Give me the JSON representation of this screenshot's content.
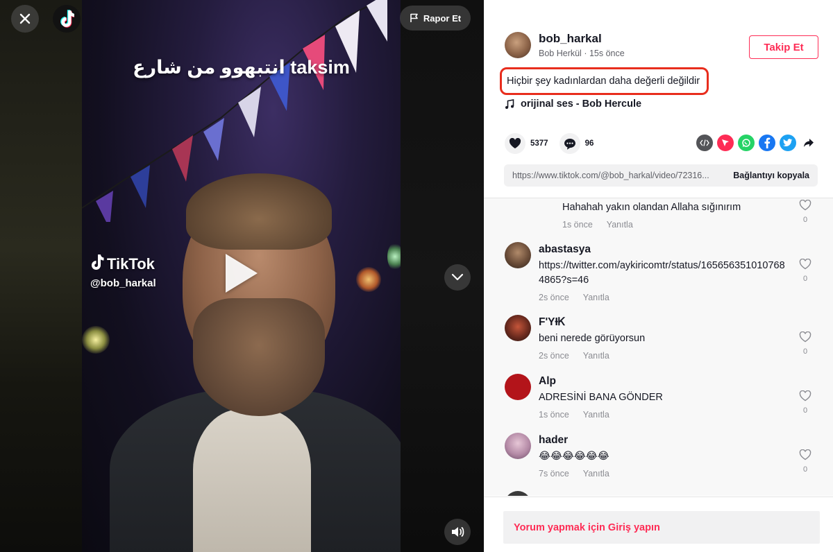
{
  "video": {
    "overlay_text": "انتبهوو من شارع taksim",
    "watermark_brand": "TikTok",
    "watermark_user": "@bob_harkal",
    "report_label": "Rapor Et"
  },
  "author": {
    "handle": "bob_harkal",
    "display_name": "Bob Herkül",
    "time": "15s önce",
    "follow_label": "Takip Et"
  },
  "caption": "Hiçbir şey kadınlardan daha değerli değildir",
  "music": "orijinal ses - Bob Hercule",
  "stats": {
    "likes": "5377",
    "comments": "96"
  },
  "share_icons": [
    "embed-icon",
    "send-icon",
    "whatsapp-icon",
    "facebook-icon",
    "twitter-icon",
    "share-arrow-icon"
  ],
  "link": {
    "url": "https://www.tiktok.com/@bob_harkal/video/72316...",
    "copy_label": "Bağlantıyı kopyala"
  },
  "comments": [
    {
      "name": "",
      "text": "Hahahah yakın olandan Allaha sığınırım",
      "time": "1s önce",
      "reply": "Yanıtla",
      "likes": "0"
    },
    {
      "name": "abastasya",
      "text": "https://twitter.com/aykiricomtr/status/1656563510107684865?s=46",
      "time": "2s önce",
      "reply": "Yanıtla",
      "likes": "0"
    },
    {
      "name": "F'YƗᏦ",
      "text": "beni nerede görüyorsun",
      "time": "2s önce",
      "reply": "Yanıtla",
      "likes": "0"
    },
    {
      "name": "Alp",
      "text": "ADRESİNİ BANA GÖNDER",
      "time": "1s önce",
      "reply": "Yanıtla",
      "likes": "0"
    },
    {
      "name": "hader",
      "text": "😂😂😂😂😂😂",
      "time": "7s önce",
      "reply": "Yanıtla",
      "likes": "0"
    }
  ],
  "footer": {
    "login_label": "Yorum yapmak için Giriş yapın"
  },
  "colors": {
    "accent": "#fe2c55",
    "highlight_border": "#e82d1d"
  }
}
